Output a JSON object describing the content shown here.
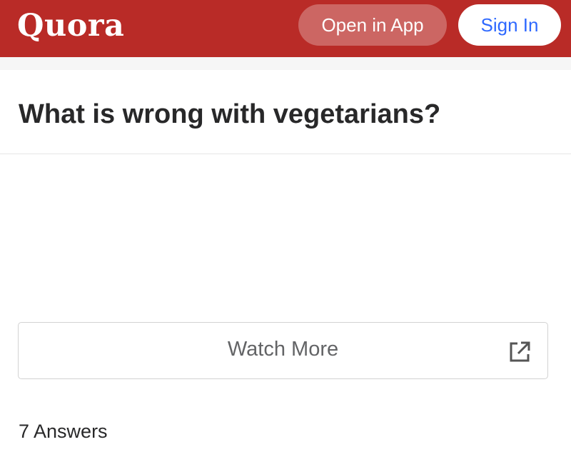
{
  "header": {
    "logo_text": "Quora",
    "open_in_app_label": "Open in App",
    "sign_in_label": "Sign In",
    "brand_color": "#b92b27",
    "link_color": "#2e69ff"
  },
  "question": {
    "title": "What is wrong with vegetarians?"
  },
  "media": {
    "watch_more_label": "Watch More",
    "icon": "external-link-icon"
  },
  "answers": {
    "count_label": "7 Answers"
  }
}
